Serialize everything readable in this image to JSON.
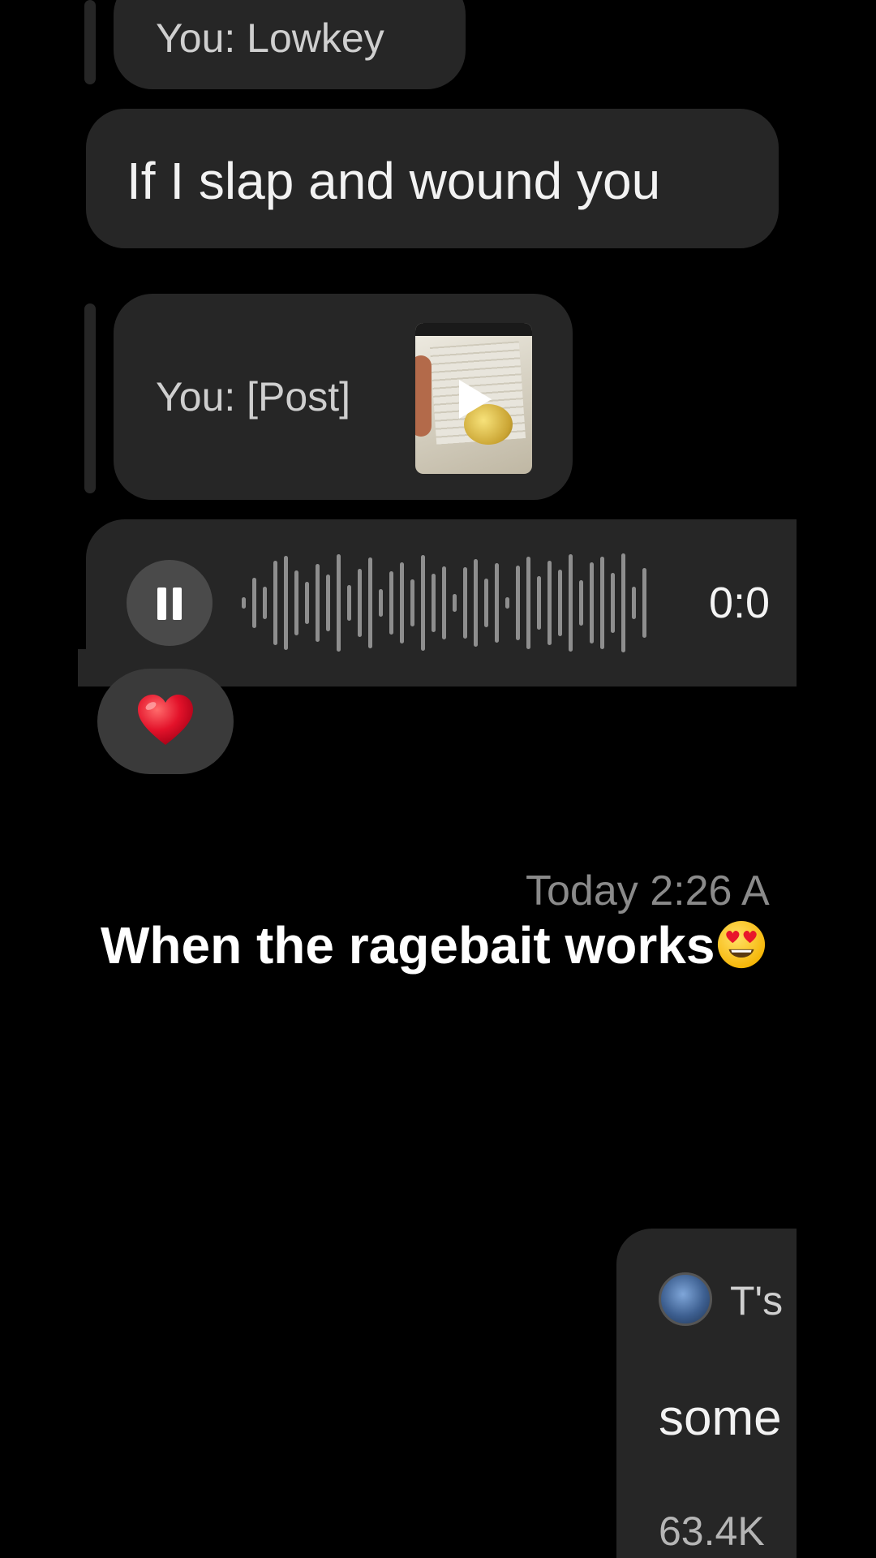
{
  "thread": {
    "reply_1": {
      "text": "You: Lowkey"
    },
    "message_1": {
      "text": "If I slap and wound you"
    },
    "reply_2": {
      "text": "You: [Post]",
      "thumbnail_icon": "play-icon"
    },
    "voice_message": {
      "time": "0:0",
      "state_icon": "pause-icon"
    },
    "reaction": {
      "emoji": "heart"
    },
    "timestamp": "Today 2:26 A"
  },
  "caption": {
    "text": "When the ragebait works",
    "emoji": "heart-eyes-face"
  },
  "shared_post": {
    "author": "T's",
    "text": "some",
    "meta": "63.4K"
  },
  "colors": {
    "background": "#000000",
    "bubble": "#262626",
    "waveform": "#8e8e8e",
    "timestamp": "#8a8a8a"
  }
}
